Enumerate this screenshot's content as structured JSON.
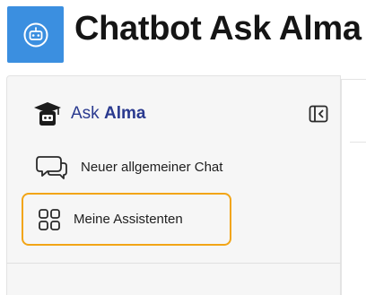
{
  "header": {
    "title": "Chatbot Ask Alma",
    "app_icon": "robot-icon",
    "accent_color": "#3b8fe0"
  },
  "sidebar": {
    "brand": {
      "ask": "Ask",
      "alma": "Alma",
      "icon": "graduation-cap-robot-icon",
      "color": "#2a3a8f"
    },
    "collapse_icon": "sidebar-collapse-icon",
    "items": [
      {
        "label": "Neuer allgemeiner Chat",
        "icon": "chat-bubbles-icon"
      },
      {
        "label": "Meine Assistenten",
        "icon": "grid-icon",
        "highlight_color": "#f2a516"
      }
    ]
  }
}
